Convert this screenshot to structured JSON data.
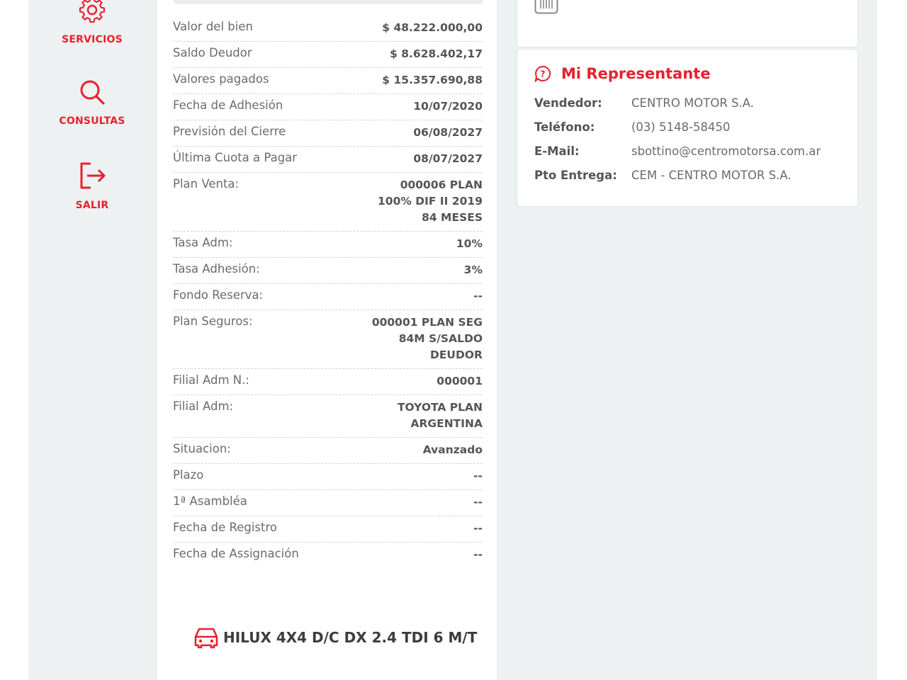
{
  "sidebar": {
    "items": [
      {
        "label": "SERVICIOS",
        "icon": "gear-icon"
      },
      {
        "label": "CONSULTAS",
        "icon": "search-icon"
      },
      {
        "label": "SALIR",
        "icon": "logout-icon"
      }
    ]
  },
  "details": {
    "rows": [
      {
        "label": "Valor del bien",
        "value": "$ 48.222.000,00"
      },
      {
        "label": "Saldo Deudor",
        "value": "$ 8.628.402,17"
      },
      {
        "label": "Valores pagados",
        "value": "$ 15.357.690,88"
      },
      {
        "label": "Fecha de Adhesión",
        "value": "10/07/2020"
      },
      {
        "label": "Previsión del Cierre",
        "value": "06/08/2027"
      },
      {
        "label": "Última Cuota a Pagar",
        "value": "08/07/2027"
      },
      {
        "label": "Plan Venta:",
        "value": "000006 PLAN 100% DIF II 2019 84 MESES"
      },
      {
        "label": "Tasa Adm:",
        "value": "10%"
      },
      {
        "label": "Tasa Adhesión:",
        "value": "3%"
      },
      {
        "label": "Fondo Reserva:",
        "value": "--"
      },
      {
        "label": "Plan Seguros:",
        "value": "000001 PLAN SEG 84M S/SALDO DEUDOR"
      },
      {
        "label": "Filial Adm N.:",
        "value": "000001"
      },
      {
        "label": "Filial Adm:",
        "value": "TOYOTA PLAN ARGENTINA"
      },
      {
        "label": "Situacion:",
        "value": "Avanzado"
      },
      {
        "label": "Plazo",
        "value": "--"
      },
      {
        "label": "1ª Asambléa",
        "value": "--"
      },
      {
        "label": "Fecha de Registro",
        "value": "--"
      },
      {
        "label": "Fecha de Assignación",
        "value": "--"
      }
    ],
    "vehicle": "HILUX 4X4 D/C DX 2.4 TDI 6 M/T"
  },
  "representante": {
    "title": "Mi Representante",
    "vendedor_label": "Vendedor:",
    "vendedor": "CENTRO MOTOR S.A.",
    "telefono_label": "Teléfono:",
    "telefono": "(03) 5148-58450",
    "email_label": "E-Mail:",
    "email": "sbottino@centromotorsa.com.ar",
    "entrega_label": "Pto Entrega:",
    "entrega": "CEM - CENTRO MOTOR S.A."
  },
  "colors": {
    "accent": "#e8202e",
    "panel_bg": "#eef1f2"
  }
}
